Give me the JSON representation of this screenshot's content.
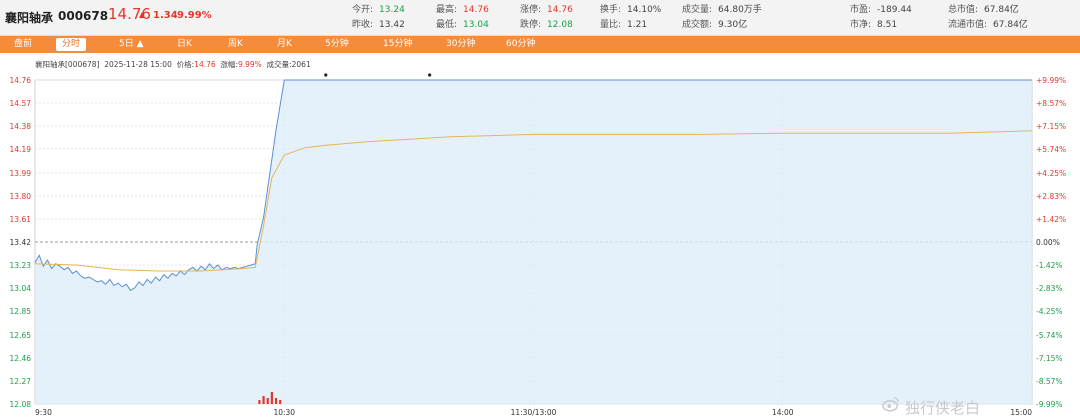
{
  "header": {
    "stock_name": "襄阳轴承",
    "stock_code": "000678",
    "price": "14.76",
    "change": "1.34",
    "change_pct": "9.99%",
    "quotes": [
      {
        "label": "今开:",
        "value": "13.24",
        "color": "dn"
      },
      {
        "label": "最高:",
        "value": "14.76",
        "color": "up"
      },
      {
        "label": "涨停:",
        "value": "14.76",
        "color": "up"
      },
      {
        "label": "换手:",
        "value": "14.10%",
        "color": "nt"
      },
      {
        "label": "成交量:",
        "value": "64.80万手",
        "color": "nt"
      },
      {
        "label": "市盈:",
        "value": "-189.44",
        "color": "nt"
      },
      {
        "label": "总市值:",
        "value": "67.84亿",
        "color": "nt"
      },
      {
        "label": "昨收:",
        "value": "13.42",
        "color": "nt"
      },
      {
        "label": "最低:",
        "value": "13.04",
        "color": "dn"
      },
      {
        "label": "跌停:",
        "value": "12.08",
        "color": "dn"
      },
      {
        "label": "量比:",
        "value": "1.21",
        "color": "nt"
      },
      {
        "label": "成交额:",
        "value": "9.30亿",
        "color": "nt"
      },
      {
        "label": "市净:",
        "value": "8.51",
        "color": "nt"
      },
      {
        "label": "流通市值:",
        "value": "67.84亿",
        "color": "nt"
      }
    ]
  },
  "tabs": [
    "盘前",
    "分时",
    "5日 ▲",
    "日K",
    "周K",
    "月K",
    "5分钟",
    "15分钟",
    "30分钟",
    "60分钟"
  ],
  "active_tab": 1,
  "info_line": {
    "name": "襄阳轴承",
    "code": "[000678]",
    "datetime": "2025-11-28 15:00",
    "price_label": "价格",
    "price": "14.76",
    "pct_label": "涨幅",
    "pct": "9.99%",
    "volume_label": "成交量",
    "volume": "2061"
  },
  "chart_data": {
    "type": "line",
    "prev_close": 13.42,
    "ylim": [
      12.08,
      14.76
    ],
    "y_ticks": [
      "14.76",
      "14.57",
      "14.38",
      "14.19",
      "13.99",
      "13.80",
      "13.61",
      "13.42",
      "13.23",
      "13.04",
      "12.85",
      "12.65",
      "12.46",
      "12.27",
      "12.08"
    ],
    "y_tick_values": [
      14.76,
      14.57,
      14.38,
      14.19,
      13.99,
      13.8,
      13.61,
      13.42,
      13.23,
      13.04,
      12.85,
      12.65,
      12.46,
      12.27,
      12.08
    ],
    "pct_ticks": [
      "+9.99%",
      "+8.57%",
      "+7.15%",
      "+5.74%",
      "+4.25%",
      "+2.83%",
      "+1.42%",
      "0.00%",
      "-1.42%",
      "-2.83%",
      "-4.25%",
      "-5.74%",
      "-7.15%",
      "-8.57%",
      "-9.99%"
    ],
    "x_ticks": [
      {
        "label": "9:30",
        "minute": 0
      },
      {
        "label": "10:30",
        "minute": 60
      },
      {
        "label": "11:30/13:00",
        "minute": 120
      },
      {
        "label": "14:00",
        "minute": 180
      },
      {
        "label": "15:00",
        "minute": 240
      }
    ],
    "x_range": [
      0,
      240
    ],
    "series": [
      {
        "color": "#5b8fd4",
        "x": [
          0,
          1,
          2,
          3,
          4,
          5,
          6,
          7,
          8,
          9,
          10,
          11,
          12,
          13,
          14,
          15,
          16,
          17,
          18,
          19,
          20,
          21,
          22,
          23,
          24,
          25,
          26,
          27,
          28,
          29,
          30,
          31,
          32,
          33,
          34,
          35,
          36,
          37,
          38,
          39,
          40,
          41,
          42,
          43,
          44,
          45,
          46,
          47,
          48,
          49,
          50,
          51,
          52,
          53,
          53.5,
          55,
          56,
          57,
          58,
          60,
          65,
          70,
          80,
          100,
          120,
          150,
          180,
          210,
          240
        ],
        "values": [
          13.25,
          13.31,
          13.22,
          13.27,
          13.2,
          13.24,
          13.22,
          13.19,
          13.21,
          13.16,
          13.18,
          13.14,
          13.12,
          13.13,
          13.11,
          13.09,
          13.1,
          13.07,
          13.11,
          13.06,
          13.08,
          13.05,
          13.07,
          13.02,
          13.04,
          13.09,
          13.06,
          13.11,
          13.08,
          13.13,
          13.1,
          13.15,
          13.12,
          13.16,
          13.14,
          13.18,
          13.15,
          13.19,
          13.21,
          13.18,
          13.22,
          13.19,
          13.24,
          13.2,
          13.23,
          13.19,
          13.21,
          13.2,
          13.21,
          13.2,
          13.21,
          13.22,
          13.23,
          13.24,
          13.4,
          13.62,
          13.86,
          14.1,
          14.34,
          14.76,
          14.76,
          14.76,
          14.76,
          14.76,
          14.76,
          14.76,
          14.76,
          14.76,
          14.76
        ]
      },
      {
        "color": "#e8b35a",
        "x": [
          0,
          10,
          20,
          30,
          40,
          50,
          53,
          55,
          57,
          60,
          65,
          70,
          80,
          90,
          100,
          110,
          120,
          140,
          160,
          180,
          200,
          220,
          240
        ],
        "values": [
          13.24,
          13.23,
          13.19,
          13.18,
          13.18,
          13.2,
          13.21,
          13.55,
          13.95,
          14.14,
          14.2,
          14.22,
          14.25,
          14.27,
          14.29,
          14.3,
          14.31,
          14.31,
          14.31,
          14.32,
          14.32,
          14.32,
          14.34
        ]
      }
    ],
    "volume_x": [
      54,
      55,
      56,
      57,
      58,
      59
    ],
    "volume_values": [
      2,
      4,
      3,
      6,
      3,
      2
    ]
  },
  "watermark": "独行侠老白",
  "colors": {
    "accent": "#f48c3c",
    "up": "#e0392b",
    "down": "#16a34a"
  }
}
